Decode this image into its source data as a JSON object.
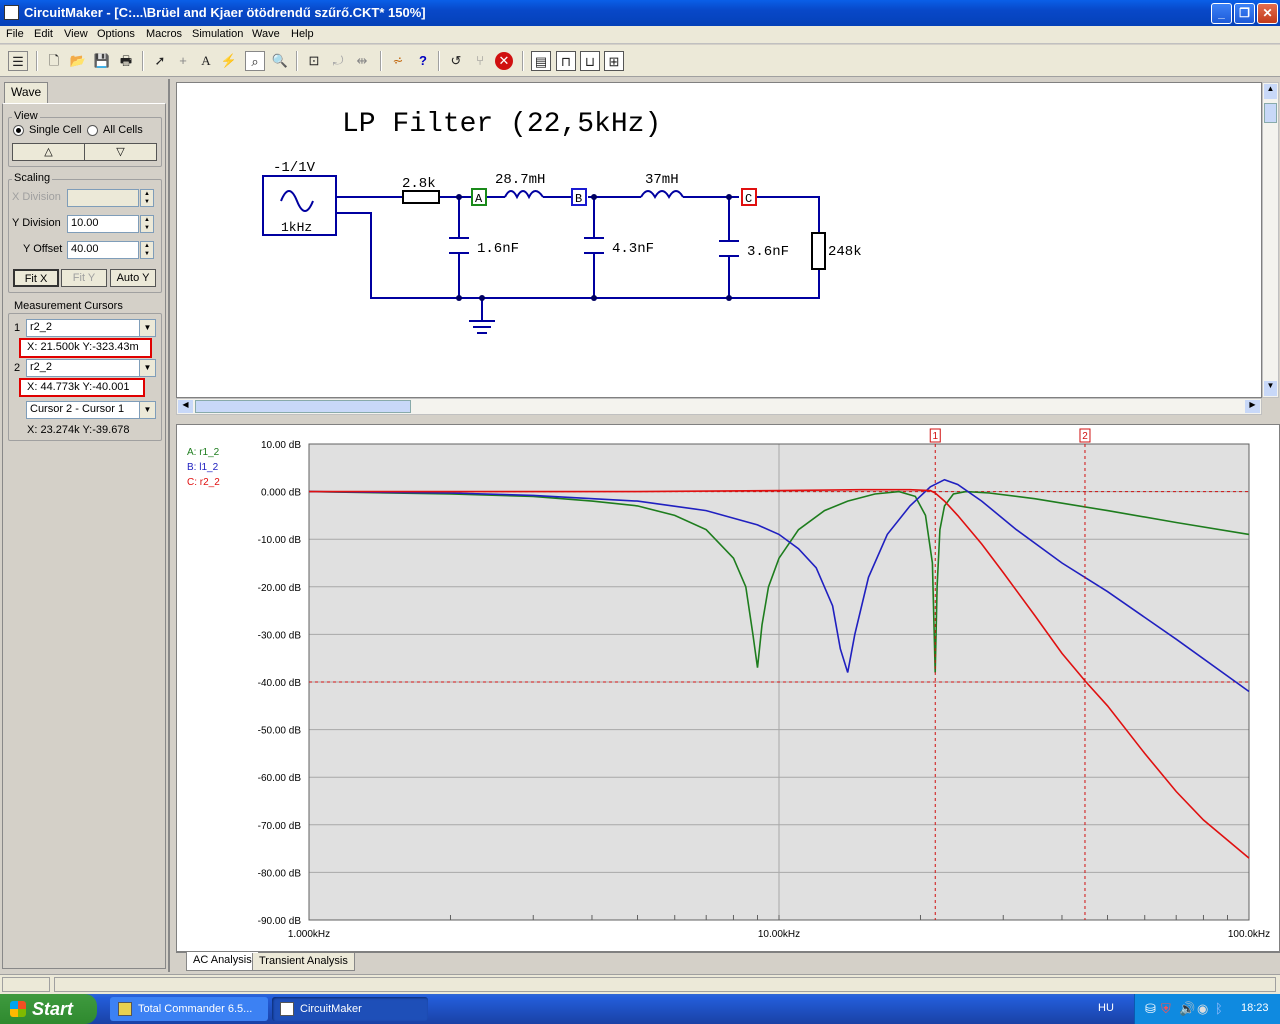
{
  "window": {
    "title": "CircuitMaker - [C:...\\Brüel and Kjaer ötödrendű szűrő.CKT* 150%]"
  },
  "menu": [
    "File",
    "Edit",
    "View",
    "Options",
    "Macros",
    "Simulation",
    "Wave",
    "Help"
  ],
  "panel": {
    "tab": "Wave",
    "view_group": "View",
    "single_cell": "Single Cell",
    "all_cells": "All Cells",
    "scaling_group": "Scaling",
    "x_division_label": "X Division",
    "x_division_value": "",
    "y_division_label": "Y Division",
    "y_division_value": "10.00",
    "y_offset_label": "Y Offset",
    "y_offset_value": "40.00",
    "fit_x": "Fit X",
    "fit_y": "Fit Y",
    "auto_y": "Auto Y",
    "cursors_group": "Measurement Cursors",
    "cursor1_num": "1",
    "cursor1_select": "r2_2",
    "cursor1_readout": "X: 21.500k  Y:-323.43m",
    "cursor2_num": "2",
    "cursor2_select": "r2_2",
    "cursor2_readout": "X: 44.773k  Y:-40.001",
    "diff_select": "Cursor 2 - Cursor 1",
    "diff_readout": "X: 23.274k  Y:-39.678"
  },
  "schematic": {
    "title": "LP Filter (22,5kHz)",
    "source_amp": "-1/1V",
    "source_freq": "1kHz",
    "r1": "2.8k",
    "l1": "28.7mH",
    "l2": "37mH",
    "c1": "1.6nF",
    "c2": "4.3nF",
    "c3": "3.6nF",
    "rload": "248k",
    "probe_a": "A",
    "probe_b": "B",
    "probe_c": "C"
  },
  "chart_data": {
    "type": "line",
    "xscale": "log",
    "xlim": [
      1000,
      100000
    ],
    "ylim": [
      -90,
      10
    ],
    "grid": true,
    "xticklabels": [
      "1.000kHz",
      "10.00kHz",
      "100.0kHz"
    ],
    "yticklabels": [
      "10.00 dB",
      "0.000 dB",
      "-10.00 dB",
      "-20.00 dB",
      "-30.00 dB",
      "-40.00 dB",
      "-50.00 dB",
      "-60.00 dB",
      "-70.00 dB",
      "-80.00 dB",
      "-90.00 dB"
    ],
    "legend": [
      "A: r1_2",
      "B: l1_2",
      "C: r2_2"
    ],
    "cursors": [
      {
        "label": "1",
        "x": 21500
      },
      {
        "label": "2",
        "x": 44773
      }
    ],
    "ref_lines_y": [
      0,
      -40
    ],
    "series": [
      {
        "name": "A: r1_2",
        "color": "#1e7d1e",
        "x": [
          1000,
          2000,
          3000,
          4000,
          5000,
          6000,
          7000,
          8000,
          8500,
          8800,
          9000,
          9200,
          9500,
          10000,
          11000,
          12500,
          14000,
          16000,
          18000,
          19500,
          20500,
          21200,
          21500,
          21700,
          22000,
          22500,
          23500,
          25000,
          28000,
          35000,
          50000,
          70000,
          100000
        ],
        "y": [
          0,
          -0.5,
          -1,
          -2,
          -3,
          -5,
          -8,
          -14,
          -20,
          -30,
          -37,
          -28,
          -20,
          -14,
          -8,
          -4,
          -2,
          -0.5,
          0,
          -1,
          -5,
          -15,
          -38,
          -20,
          -8,
          -3,
          -0.5,
          0,
          -0.3,
          -1.5,
          -4,
          -6.5,
          -9
        ]
      },
      {
        "name": "B: l1_2",
        "color": "#2020c0",
        "x": [
          1000,
          2000,
          3000,
          5000,
          7000,
          9000,
          10000,
          11000,
          12000,
          13000,
          13500,
          14000,
          14500,
          15500,
          17000,
          19000,
          21000,
          22500,
          24000,
          27000,
          32000,
          40000,
          50000,
          70000,
          100000
        ],
        "y": [
          0,
          -0.3,
          -0.8,
          -2,
          -4,
          -7,
          -9,
          -12,
          -16,
          -24,
          -33,
          -38,
          -30,
          -18,
          -9,
          -3,
          1,
          2.5,
          1.5,
          -2,
          -8,
          -15,
          -21,
          -31,
          -42
        ]
      },
      {
        "name": "C: r2_2",
        "color": "#e01010",
        "x": [
          1000,
          5000,
          10000,
          15000,
          19000,
          21000,
          21500,
          22500,
          24000,
          27000,
          30000,
          35000,
          40000,
          45000,
          50000,
          60000,
          70000,
          80000,
          100000
        ],
        "y": [
          0,
          0,
          0.2,
          0.4,
          0.4,
          0.2,
          -0.3,
          -2,
          -5,
          -11,
          -17,
          -26,
          -34,
          -40,
          -45,
          -55,
          -63,
          -69,
          -77
        ]
      }
    ]
  },
  "bottom_tabs": [
    "AC Analysis",
    "Transient Analysis"
  ],
  "taskbar": {
    "start": "Start",
    "items": [
      "Total Commander 6.5...",
      "CircuitMaker"
    ],
    "lang": "HU",
    "time": "18:23"
  }
}
